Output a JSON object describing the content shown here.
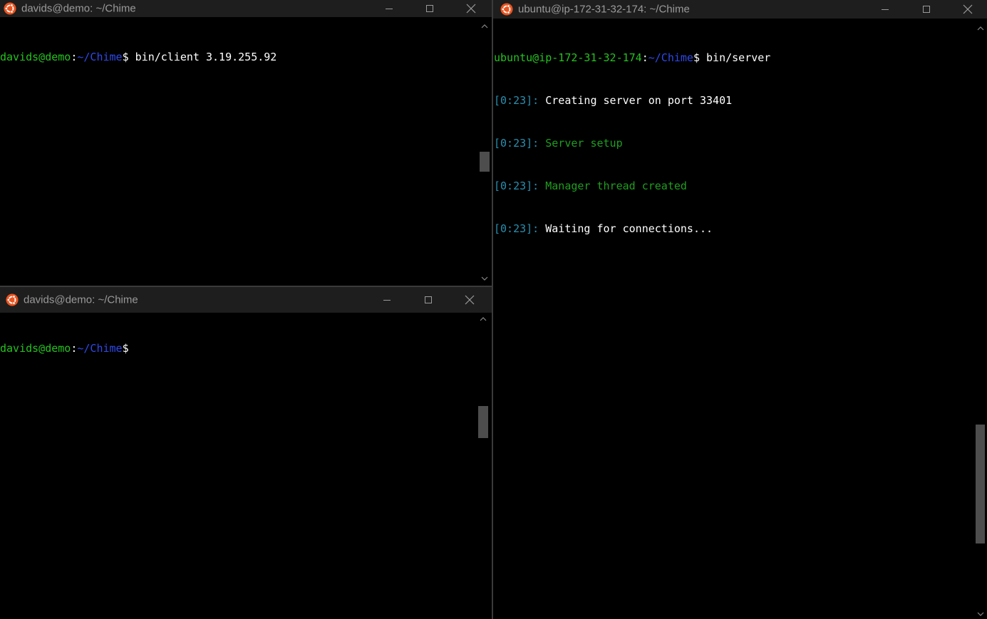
{
  "windows": {
    "client": {
      "title": "davids@demo: ~/Chime",
      "prompt_user": "davids@demo",
      "prompt_sep": ":",
      "prompt_path": "~/Chime",
      "prompt_dollar": "$",
      "command": " bin/client 3.19.255.92"
    },
    "shell": {
      "title": "davids@demo: ~/Chime",
      "prompt_user": "davids@demo",
      "prompt_sep": ":",
      "prompt_path": "~/Chime",
      "prompt_dollar": "$"
    },
    "server": {
      "title": "ubuntu@ip-172-31-32-174: ~/Chime",
      "prompt_user": "ubuntu@ip-172-31-32-174",
      "prompt_sep": ":",
      "prompt_path": "~/Chime",
      "prompt_dollar": "$",
      "command": " bin/server",
      "log": [
        {
          "time": "[0:23]:",
          "msg": " Creating server on port 33401",
          "style": "white"
        },
        {
          "time": "[0:23]:",
          "msg": " Server setup",
          "style": "green"
        },
        {
          "time": "[0:23]:",
          "msg": " Manager thread created",
          "style": "green"
        },
        {
          "time": "[0:23]:",
          "msg": " Waiting for connections...",
          "style": "white"
        }
      ]
    }
  },
  "icons": {
    "app": "ubuntu-logo-icon",
    "minimize": "minimize-icon",
    "maximize": "maximize-icon",
    "close": "close-icon",
    "scroll_up": "chevron-up-icon",
    "scroll_down": "chevron-down-icon"
  },
  "colors": {
    "titlebar_bg": "#1e1e1e",
    "title_text": "#9a9a9a",
    "prompt_user": "#25c21f",
    "prompt_path": "#2f49e8",
    "log_time": "#2a8fb0",
    "log_green": "#1f9e1f",
    "ubuntu_orange": "#e95420"
  }
}
